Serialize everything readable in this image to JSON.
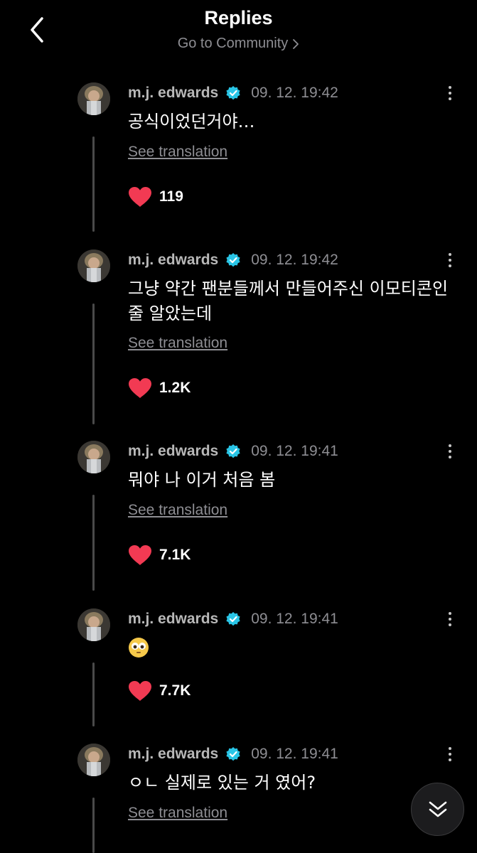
{
  "header": {
    "title": "Replies",
    "subtitle": "Go to Community"
  },
  "replies": [
    {
      "author": "m.j. edwards",
      "time": "09. 12. 19:42",
      "text": "공식이었던거야…",
      "see_translation": "See translation",
      "likes": "119"
    },
    {
      "author": "m.j. edwards",
      "time": "09. 12. 19:42",
      "text": "그냥 약간 팬분들께서 만들어주신 이모티콘인 줄 알았는데",
      "see_translation": "See translation",
      "likes": "1.2K"
    },
    {
      "author": "m.j. edwards",
      "time": "09. 12. 19:41",
      "text": "뭐야 나 이거 처음 봄",
      "see_translation": "See translation",
      "likes": "7.1K"
    },
    {
      "author": "m.j. edwards",
      "time": "09. 12. 19:41",
      "text": "",
      "likes": "7.7K"
    },
    {
      "author": "m.j. edwards",
      "time": "09. 12. 19:41",
      "text": "ㅇㄴ 실제로 있는 거 였어?",
      "see_translation": "See translation",
      "likes": ""
    }
  ],
  "colors": {
    "background": "#000000",
    "verified": "#29c5e6",
    "heart": "#f23a53",
    "muted": "#8e8e93"
  }
}
